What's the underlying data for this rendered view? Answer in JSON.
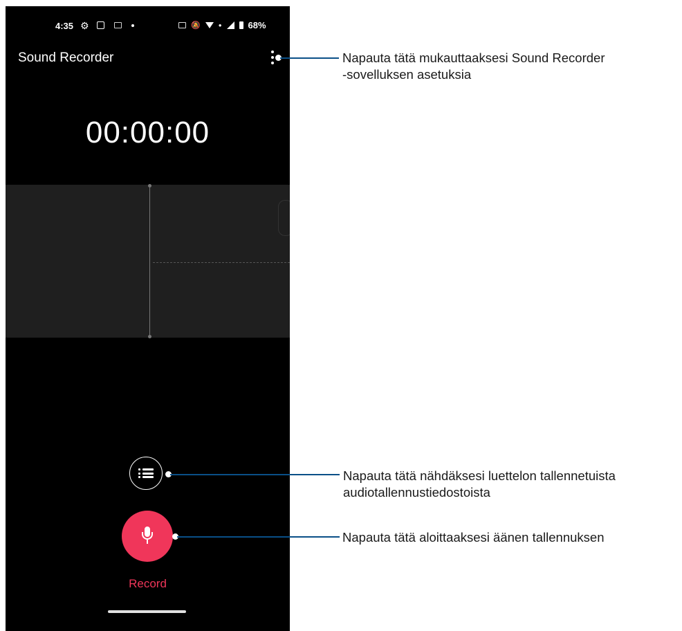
{
  "status_bar": {
    "time": "4:35",
    "battery": "68%"
  },
  "app": {
    "title": "Sound Recorder",
    "timer": "00:00:00",
    "record_label": "Record"
  },
  "icons": {
    "menu": "more-vert-icon",
    "list": "list-icon",
    "record": "mic-icon"
  },
  "callouts": {
    "settings": [
      "Napauta tätä mukauttaaksesi Sound Recorder",
      "-sovelluksen asetuksia"
    ],
    "list": [
      "Napauta tätä nähdäksesi luettelon tallennetuista",
      "audiotallennustiedostoista"
    ],
    "record": [
      "Napauta tätä aloittaaksesi äänen tallennuksen"
    ]
  },
  "colors": {
    "accent": "#f0365a",
    "callout_line": "#0a4f87",
    "screen_bg": "#000000",
    "wave_panel": "#1f1f1f"
  }
}
